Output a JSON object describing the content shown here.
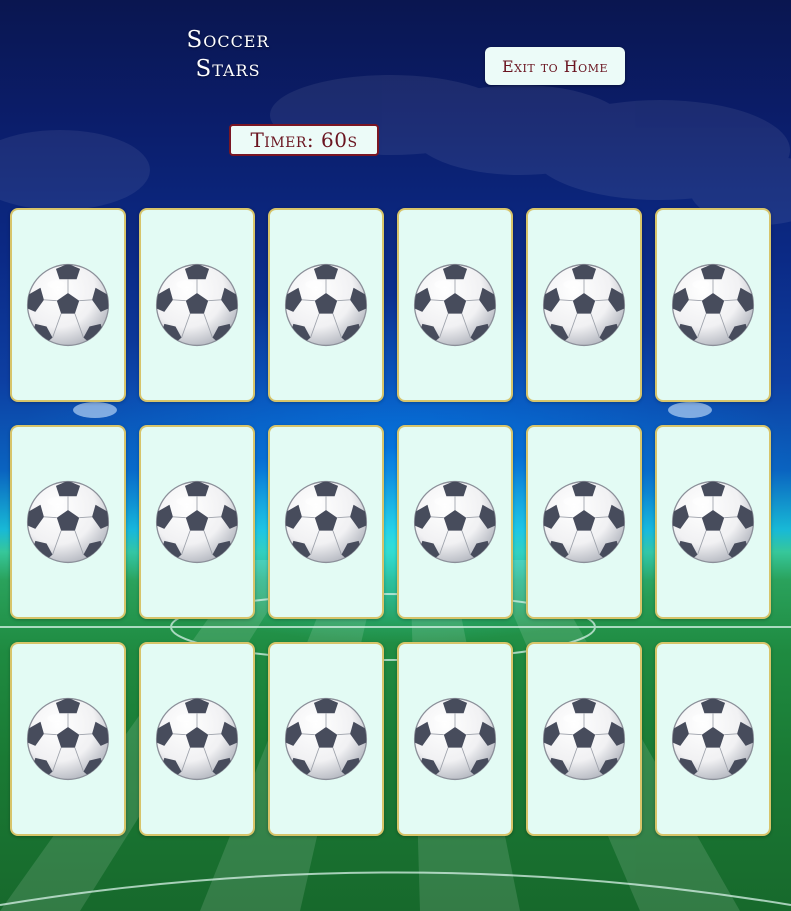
{
  "game": {
    "title_line1": "Soccer",
    "title_line2": "Stars",
    "exit_label": "Exit to Home",
    "timer_label": "Timer: 60s"
  },
  "cards": [
    {
      "icon": "soccer-ball-icon",
      "face": "down"
    },
    {
      "icon": "soccer-ball-icon",
      "face": "down"
    },
    {
      "icon": "soccer-ball-icon",
      "face": "down"
    },
    {
      "icon": "soccer-ball-icon",
      "face": "down"
    },
    {
      "icon": "soccer-ball-icon",
      "face": "down"
    },
    {
      "icon": "soccer-ball-icon",
      "face": "down"
    },
    {
      "icon": "soccer-ball-icon",
      "face": "down"
    },
    {
      "icon": "soccer-ball-icon",
      "face": "down"
    },
    {
      "icon": "soccer-ball-icon",
      "face": "down"
    },
    {
      "icon": "soccer-ball-icon",
      "face": "down"
    },
    {
      "icon": "soccer-ball-icon",
      "face": "down"
    },
    {
      "icon": "soccer-ball-icon",
      "face": "down"
    },
    {
      "icon": "soccer-ball-icon",
      "face": "down"
    },
    {
      "icon": "soccer-ball-icon",
      "face": "down"
    },
    {
      "icon": "soccer-ball-icon",
      "face": "down"
    },
    {
      "icon": "soccer-ball-icon",
      "face": "down"
    },
    {
      "icon": "soccer-ball-icon",
      "face": "down"
    },
    {
      "icon": "soccer-ball-icon",
      "face": "down"
    }
  ],
  "colors": {
    "card_face": "#e3fbf4",
    "card_border": "#d7c46a",
    "accent": "#6a1420",
    "button_bg": "#ecfbf8"
  }
}
